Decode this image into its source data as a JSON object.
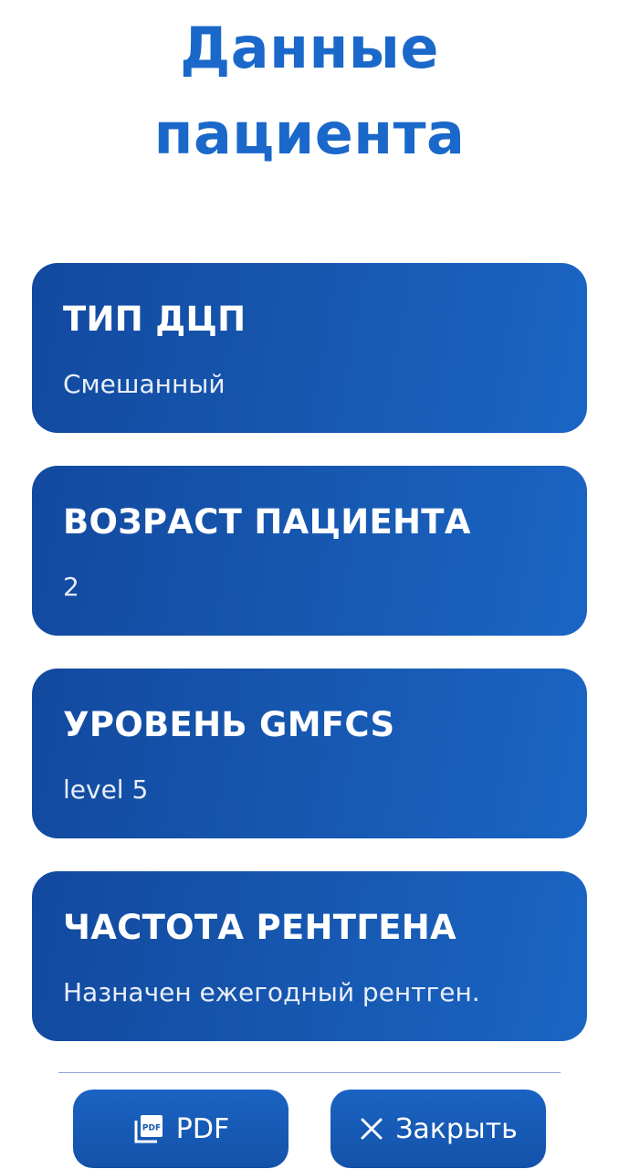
{
  "header": {
    "title_line1": "Данные",
    "title_line2": "пациента"
  },
  "cards": [
    {
      "label": "ТИП ДЦП",
      "value": "Смешанный"
    },
    {
      "label": "ВОЗРАСТ ПАЦИЕНТА",
      "value": "2"
    },
    {
      "label": "УРОВЕНЬ GMFCS",
      "value": "level 5"
    },
    {
      "label": "ЧАСТОТА РЕНТГЕНА",
      "value": "Назначен ежегодный рентген."
    }
  ],
  "footer": {
    "pdf_label": "PDF",
    "pdf_icon": "pdf-file-icon",
    "close_label": "Закрыть",
    "close_icon": "close-icon"
  },
  "colors": {
    "title": "#1a68c9",
    "card_gradient_start": "#12499f",
    "card_gradient_end": "#1a65c4",
    "text_on_card": "#ffffff"
  }
}
